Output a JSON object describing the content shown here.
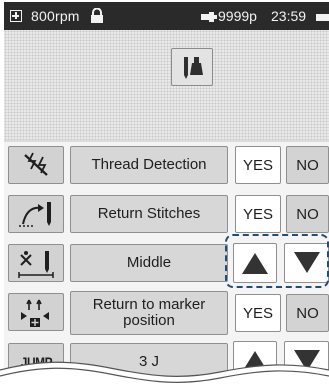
{
  "status_bar": {
    "speed": "800rpm",
    "counter": "9999p",
    "time": "23:59",
    "icons": [
      "menu-icon",
      "lock-icon",
      "bobbin-icon",
      "battery-icon"
    ]
  },
  "header": {
    "icon": "presser-foot-icon"
  },
  "settings": [
    {
      "icon": "thread-detection-icon",
      "label": "Thread Detection",
      "yes": "YES",
      "no": "NO"
    },
    {
      "icon": "return-stitches-icon",
      "label": "Return Stitches",
      "yes": "YES",
      "no": "NO"
    },
    {
      "icon": "needle-stop-position-icon",
      "label": "Middle",
      "controls": [
        "up-arrow",
        "down-arrow"
      ]
    },
    {
      "icon": "return-to-marker-icon",
      "label": "Return to marker position",
      "yes": "YES",
      "no": "NO"
    },
    {
      "icon": "jump-icon",
      "icon_text": "JUMP",
      "label": "3 J",
      "controls": [
        "up-arrow",
        "down-arrow"
      ]
    }
  ],
  "colors": {
    "status_bar": "#2a2a2a",
    "button_gray": "#d7d7d7",
    "highlight": "#1f4e79"
  }
}
